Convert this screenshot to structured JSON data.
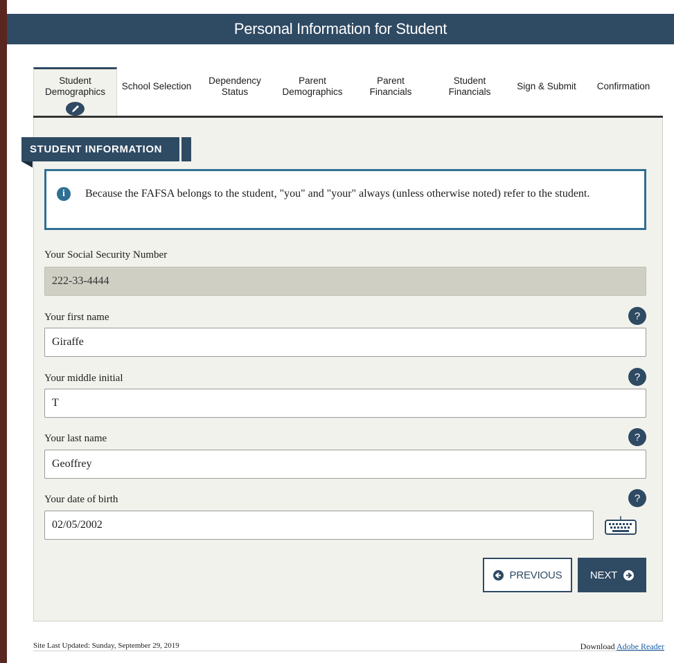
{
  "header": {
    "title": "Personal Information for Student"
  },
  "tabs": [
    {
      "label": "Student Demographics",
      "active": true
    },
    {
      "label": "School Selection"
    },
    {
      "label": "Dependency Status"
    },
    {
      "label": "Parent Demographics"
    },
    {
      "label": "Parent Financials"
    },
    {
      "label": "Student Financials"
    },
    {
      "label": "Sign & Submit"
    },
    {
      "label": "Confirmation"
    }
  ],
  "section": {
    "title": "STUDENT INFORMATION",
    "info_icon": "info-icon",
    "info_text": "Because the FAFSA belongs to the student, \"you\" and \"your\" always (unless otherwise noted) refer to the student."
  },
  "fields": {
    "ssn": {
      "label": "Your Social Security Number",
      "value": "222-33-4444"
    },
    "first_name": {
      "label": "Your first name",
      "value": "Giraffe"
    },
    "middle_initial": {
      "label": "Your middle initial",
      "value": "T"
    },
    "last_name": {
      "label": "Your last name",
      "value": "Geoffrey"
    },
    "dob": {
      "label": "Your date of birth",
      "value": "02/05/2002"
    }
  },
  "help_label": "?",
  "buttons": {
    "previous": "PREVIOUS",
    "next": "NEXT"
  },
  "footer": {
    "last_updated": "Site Last Updated: Sunday, September 29, 2019",
    "download_prefix": "Download",
    "download_link": "Adobe Reader"
  },
  "colors": {
    "navy": "#2f4a63",
    "info_border": "#2f6f94",
    "panel_bg": "#f2f2ec",
    "readonly_bg": "#cfcfc4"
  }
}
